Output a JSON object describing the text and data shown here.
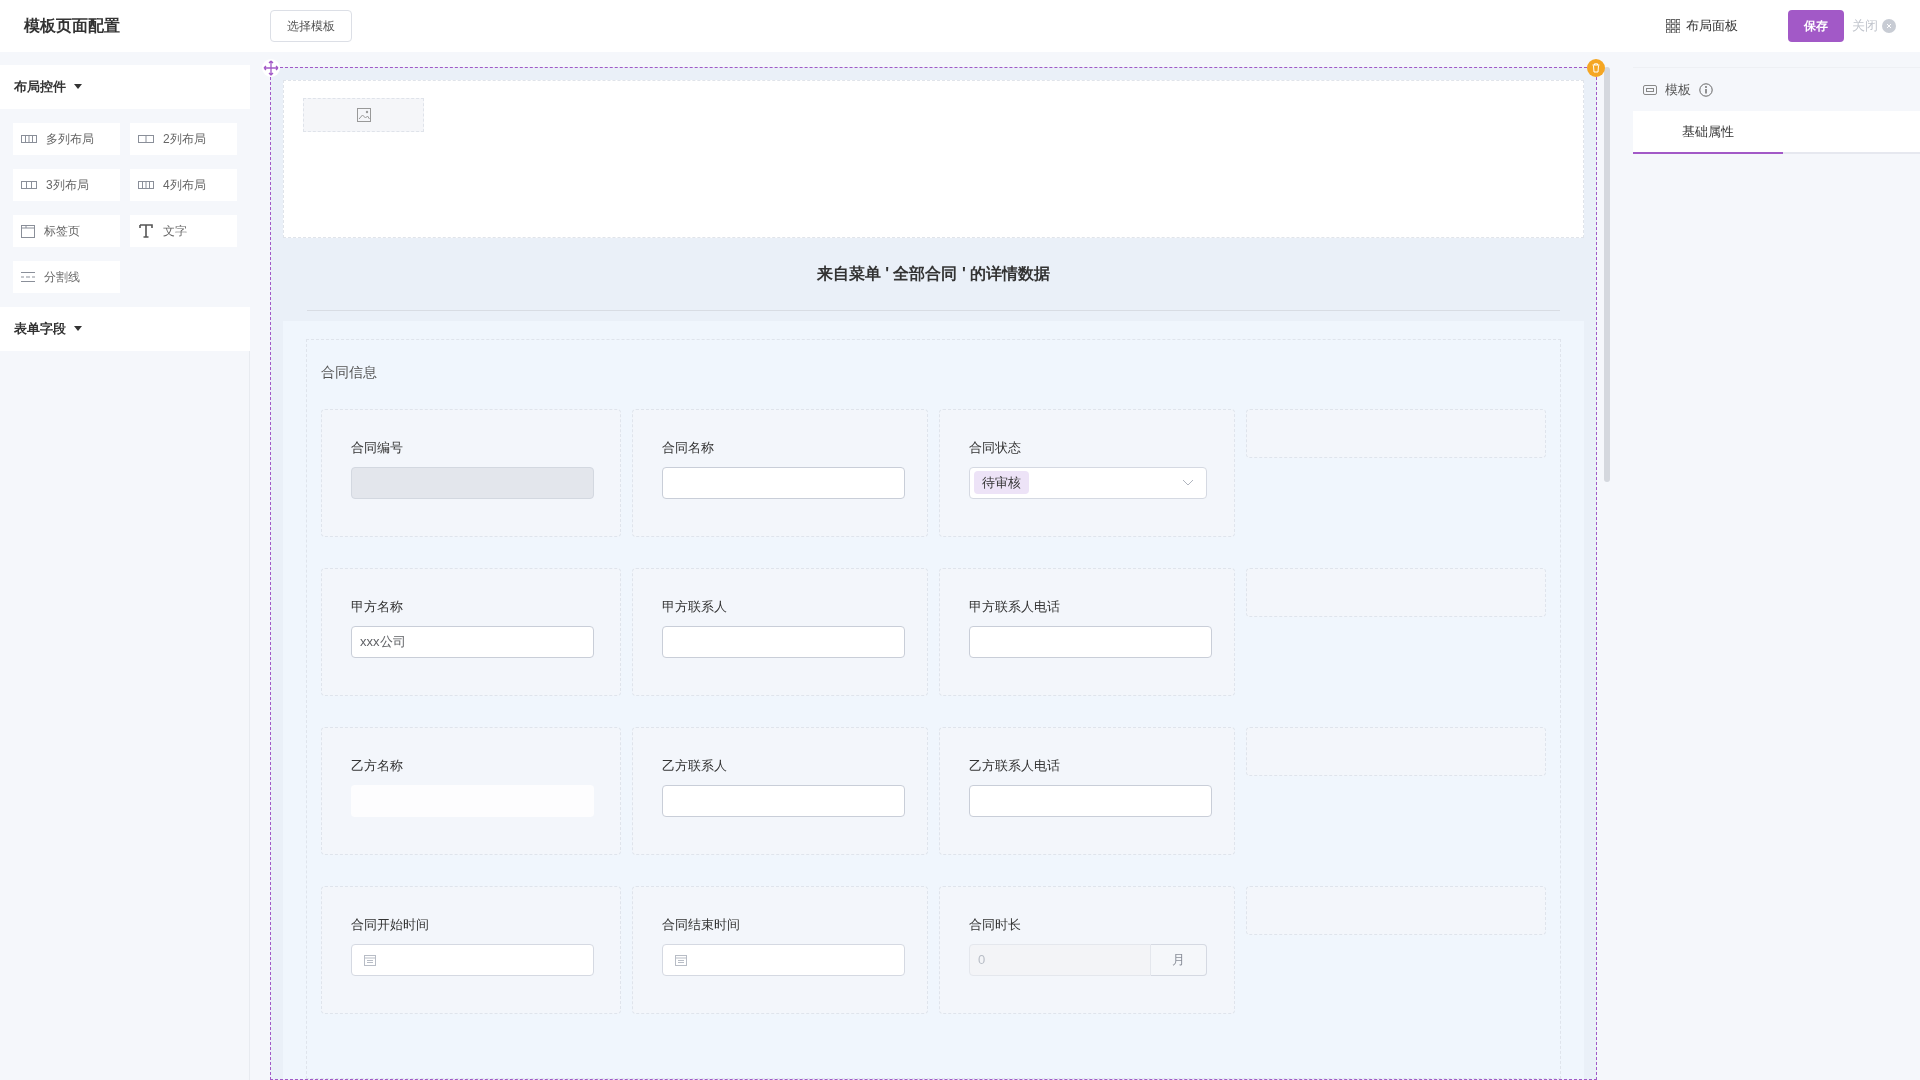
{
  "header": {
    "title": "模板页面配置",
    "template_button": "选择模板",
    "layout_panel": "布局面板",
    "save": "保存",
    "close": "关闭"
  },
  "sidebar": {
    "sections": [
      {
        "title": "布局控件",
        "expanded": true,
        "items": [
          {
            "label": "多列布局",
            "kind": "cols"
          },
          {
            "label": "2列布局",
            "kind": "two"
          },
          {
            "label": "3列布局",
            "kind": "three"
          },
          {
            "label": "4列布局",
            "kind": "four"
          },
          {
            "label": "标签页",
            "kind": "tabs"
          },
          {
            "label": "文字",
            "kind": "text"
          },
          {
            "label": "分割线",
            "kind": "divider"
          }
        ]
      },
      {
        "title": "表单字段",
        "expanded": true
      }
    ]
  },
  "canvas": {
    "heading": "来自菜单 ' 全部合同 ' 的详情数据",
    "group_title": "合同信息",
    "rows": [
      {
        "fields": [
          {
            "label": "合同编号",
            "kind": "input",
            "disabled": true
          },
          {
            "label": "合同名称",
            "kind": "input",
            "disabled": false
          },
          {
            "label": "合同状态",
            "kind": "select",
            "tag": "待审核"
          }
        ]
      },
      {
        "fields": [
          {
            "label": "甲方名称",
            "kind": "input",
            "disabled": false,
            "value": "xxx公司"
          },
          {
            "label": "甲方联系人",
            "kind": "input",
            "disabled": false
          },
          {
            "label": "甲方联系人电话",
            "kind": "input",
            "disabled": false
          }
        ]
      },
      {
        "fields": [
          {
            "label": "乙方名称",
            "kind": "plain"
          },
          {
            "label": "乙方联系人",
            "kind": "input",
            "disabled": false
          },
          {
            "label": "乙方联系人电话",
            "kind": "input",
            "disabled": false
          }
        ]
      },
      {
        "fields": [
          {
            "label": "合同开始时间",
            "kind": "date"
          },
          {
            "label": "合同结束时间",
            "kind": "date"
          },
          {
            "label": "合同时长",
            "kind": "number",
            "placeholder": "0",
            "suffix": "月"
          }
        ]
      }
    ]
  },
  "properties": {
    "title": "模板",
    "tabs": [
      {
        "label": "基础属性",
        "selected": true
      }
    ]
  }
}
